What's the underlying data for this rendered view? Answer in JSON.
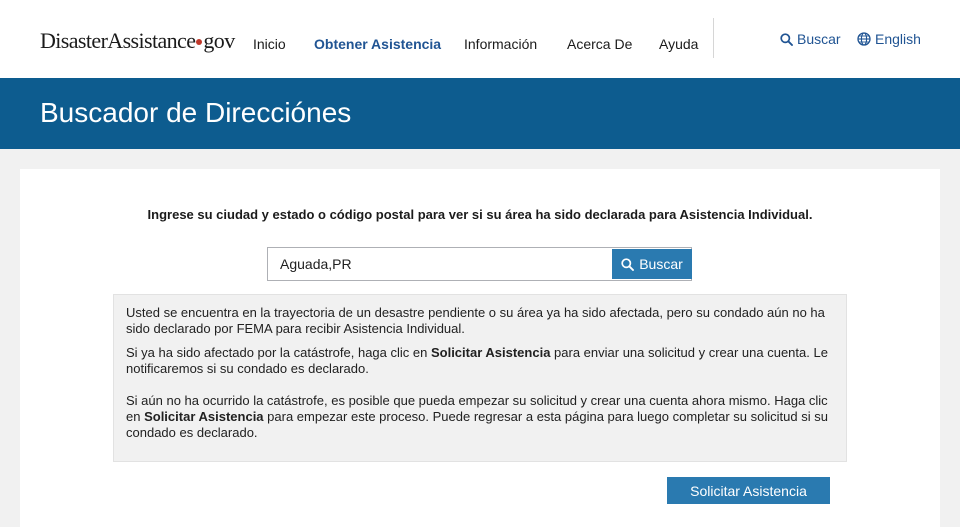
{
  "header": {
    "logo": {
      "part1": "Disaster",
      "part2": "Assistance",
      "part3": "gov"
    },
    "nav": [
      {
        "label": "Inicio",
        "active": false
      },
      {
        "label": "Obtener Asistencia",
        "active": true
      },
      {
        "label": "Información",
        "active": false
      },
      {
        "label": "Acerca De",
        "active": false
      },
      {
        "label": "Ayuda",
        "active": false
      }
    ],
    "search_link": {
      "label": "Buscar",
      "icon": "search-icon"
    },
    "language_link": {
      "label": "English",
      "icon": "globe-icon"
    }
  },
  "banner": {
    "title": "Buscador de Direcciónes"
  },
  "main": {
    "instructions": "Ingrese su ciudad y estado o código postal para ver si su área ha sido declarada para Asistencia Individual.",
    "search": {
      "value": "Aguada,PR",
      "button_label": "Buscar",
      "button_icon": "search-icon"
    },
    "notice": {
      "p1": "Usted se encuentra en la trayectoria de un desastre pendiente o su área ya ha sido afectada, pero su condado aún no ha sido declarado por FEMA para recibir Asistencia Individual.",
      "p2_before": "Si ya ha sido afectado por la catástrofe, haga clic en ",
      "p2_bold": "Solicitar Asistencia",
      "p2_after": " para enviar una solicitud y crear una cuenta. Le notificaremos si su condado es declarado.",
      "p3_before": "Si aún no ha ocurrido la catástrofe, es posible que pueda empezar su solicitud y crear una cuenta ahora mismo. Haga clic en ",
      "p3_bold": "Solicitar Asistencia",
      "p3_after": " para empezar este proceso. Puede regresar a esta página para luego completar su solicitud si su condado es declarado."
    },
    "apply_button": "Solicitar Asistencia"
  },
  "colors": {
    "banner": "#0d5c8f",
    "button": "#2a7ab0",
    "link": "#205493",
    "logo_dot": "#c0392b"
  }
}
